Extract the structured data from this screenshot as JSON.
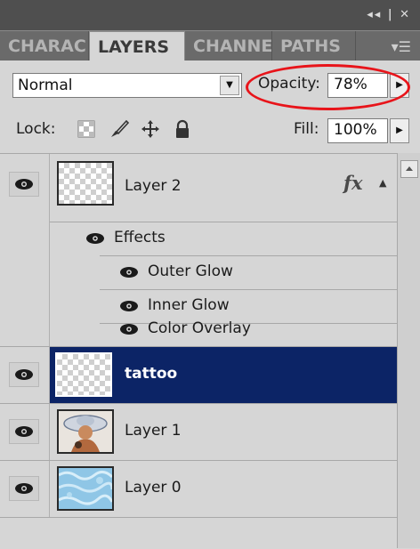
{
  "window": {
    "controls": "◂◂ | ✕"
  },
  "tabs": [
    {
      "label": "CHARAC",
      "active": false
    },
    {
      "label": "LAYERS",
      "active": true
    },
    {
      "label": "CHANNE",
      "active": false
    },
    {
      "label": "PATHS",
      "active": false
    }
  ],
  "panel_menu_icon": "menu-icon",
  "options": {
    "blend_mode": "Normal",
    "opacity_label": "Opacity:",
    "opacity_value": "78%",
    "lock_label": "Lock:",
    "fill_label": "Fill:",
    "fill_value": "100%"
  },
  "layers": [
    {
      "name": "Layer 2",
      "has_fx": true,
      "fx_label": "fx",
      "effects_label": "Effects",
      "effects": [
        "Outer Glow",
        "Inner Glow",
        "Color Overlay"
      ]
    },
    {
      "name": "tattoo",
      "selected": true
    },
    {
      "name": "Layer 1"
    },
    {
      "name": "Layer 0"
    }
  ],
  "colors": {
    "selection": "#0c2466",
    "highlight_ring": "#e8141a"
  }
}
